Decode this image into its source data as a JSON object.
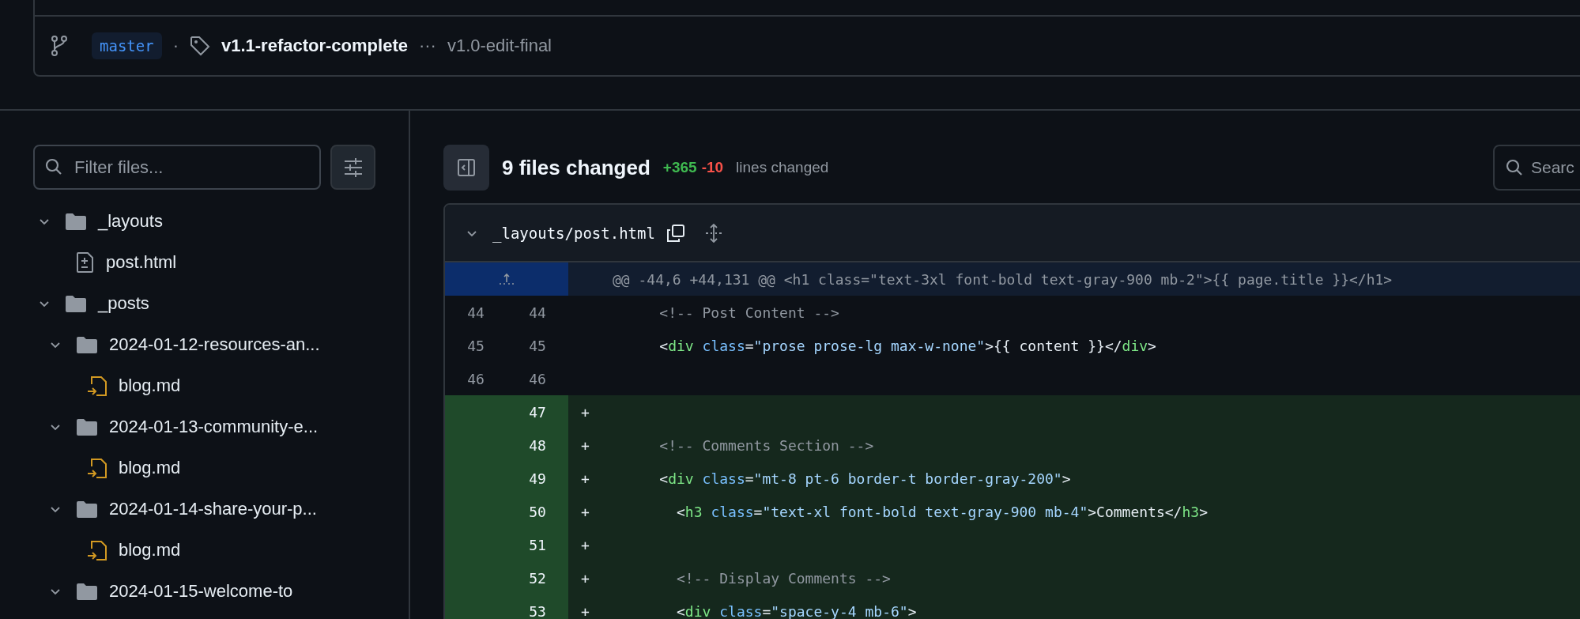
{
  "refs": {
    "branch": "master",
    "separator": "·",
    "tag": "v1.1-refactor-complete",
    "dots": "···",
    "compare": "v1.0-edit-final"
  },
  "sidebar": {
    "filter": {
      "placeholder": "Filter files..."
    },
    "tree": [
      {
        "name": "_layouts",
        "kind": "folder",
        "expanded": true,
        "children": [
          {
            "name": "post.html",
            "kind": "modified"
          }
        ]
      },
      {
        "name": "_posts",
        "kind": "folder",
        "expanded": true,
        "children": [
          {
            "name": "2024-01-12-resources-an...",
            "kind": "folder",
            "expanded": true,
            "children": [
              {
                "name": "blog.md",
                "kind": "renamed"
              }
            ]
          },
          {
            "name": "2024-01-13-community-e...",
            "kind": "folder",
            "expanded": true,
            "children": [
              {
                "name": "blog.md",
                "kind": "renamed"
              }
            ]
          },
          {
            "name": "2024-01-14-share-your-p...",
            "kind": "folder",
            "expanded": true,
            "children": [
              {
                "name": "blog.md",
                "kind": "renamed"
              }
            ]
          },
          {
            "name": "2024-01-15-welcome-to",
            "kind": "folder",
            "expanded": true
          }
        ]
      }
    ]
  },
  "summary": {
    "title": "9 files changed",
    "additions": "+365",
    "deletions": "-10",
    "label": "lines changed",
    "search": "Searc"
  },
  "diff": {
    "path": "_layouts/post.html",
    "hunk": "@@ -44,6 +44,131 @@ <h1 class=\"text-3xl font-bold text-gray-900 mb-2\">{{ page.title }}</h1>",
    "lines": [
      {
        "kind": "context",
        "old": "44",
        "new": "44",
        "tokens": [
          {
            "kind": "comment",
            "text": "    <!-- Post Content -->"
          }
        ]
      },
      {
        "kind": "context",
        "old": "45",
        "new": "45",
        "tokens": [
          {
            "kind": "plain",
            "text": "    <"
          },
          {
            "kind": "tag",
            "text": "div"
          },
          {
            "kind": "attr",
            "text": " class"
          },
          {
            "kind": "plain",
            "text": "="
          },
          {
            "kind": "string",
            "text": "\"prose prose-lg max-w-none\""
          },
          {
            "kind": "plain",
            "text": ">{{ content }}</"
          },
          {
            "kind": "tag",
            "text": "div"
          },
          {
            "kind": "plain",
            "text": ">"
          }
        ]
      },
      {
        "kind": "context",
        "old": "46",
        "new": "46"
      },
      {
        "kind": "addition",
        "new": "47",
        "sign": "+"
      },
      {
        "kind": "addition",
        "new": "48",
        "sign": "+",
        "tokens": [
          {
            "kind": "comment",
            "text": "    <!-- Comments Section -->"
          }
        ]
      },
      {
        "kind": "addition",
        "new": "49",
        "sign": "+",
        "tokens": [
          {
            "kind": "plain",
            "text": "    <"
          },
          {
            "kind": "tag",
            "text": "div"
          },
          {
            "kind": "attr",
            "text": " class"
          },
          {
            "kind": "plain",
            "text": "="
          },
          {
            "kind": "string",
            "text": "\"mt-8 pt-6 border-t border-gray-200\""
          },
          {
            "kind": "plain",
            "text": ">"
          }
        ]
      },
      {
        "kind": "addition",
        "new": "50",
        "sign": "+",
        "tokens": [
          {
            "kind": "plain",
            "text": "      <"
          },
          {
            "kind": "tag",
            "text": "h3"
          },
          {
            "kind": "attr",
            "text": " class"
          },
          {
            "kind": "plain",
            "text": "="
          },
          {
            "kind": "string",
            "text": "\"text-xl font-bold text-gray-900 mb-4\""
          },
          {
            "kind": "plain",
            "text": ">Comments</"
          },
          {
            "kind": "tag",
            "text": "h3"
          },
          {
            "kind": "plain",
            "text": ">"
          }
        ]
      },
      {
        "kind": "addition",
        "new": "51",
        "sign": "+"
      },
      {
        "kind": "addition",
        "new": "52",
        "sign": "+",
        "tokens": [
          {
            "kind": "comment",
            "text": "      <!-- Display Comments -->"
          }
        ]
      },
      {
        "kind": "addition",
        "new": "53",
        "sign": "+",
        "tokens": [
          {
            "kind": "plain",
            "text": "      <"
          },
          {
            "kind": "tag",
            "text": "div"
          },
          {
            "kind": "attr",
            "text": " class"
          },
          {
            "kind": "plain",
            "text": "="
          },
          {
            "kind": "string",
            "text": "\"space-y-4 mb-6\""
          },
          {
            "kind": "plain",
            "text": ">"
          }
        ]
      }
    ]
  }
}
